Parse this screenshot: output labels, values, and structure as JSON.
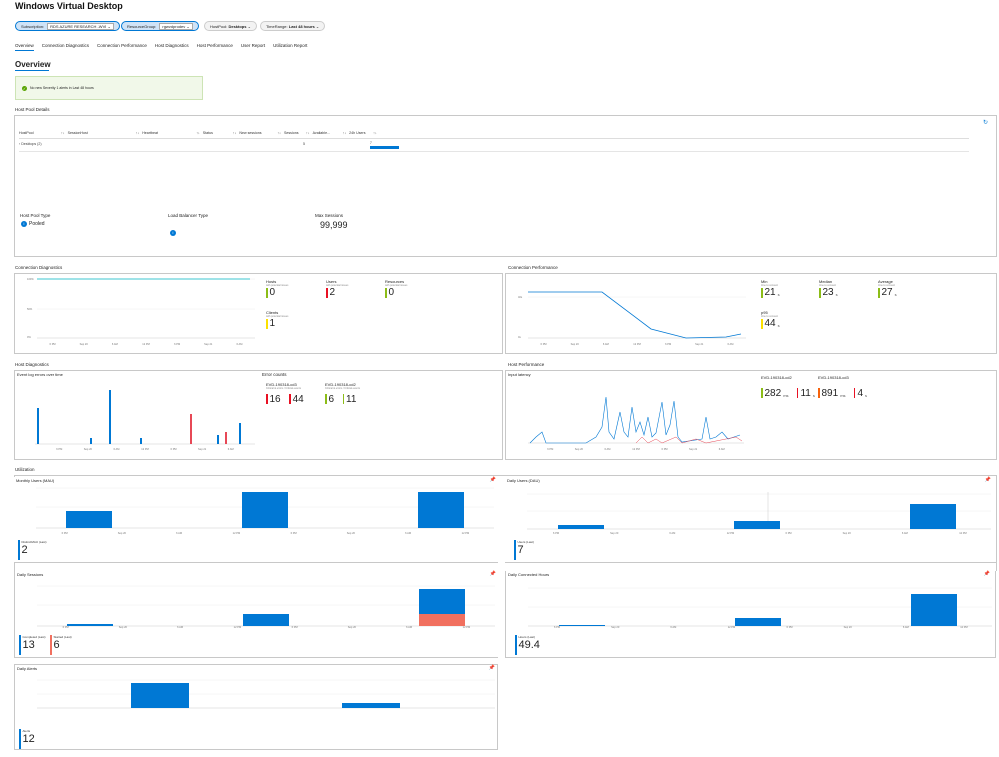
{
  "app_title": "Windows Virtual Desktop",
  "filters": [
    {
      "label": "Subscription:",
      "value": "RDS AZURE RESEARCH -WVI"
    },
    {
      "label": "ResourceGroup:",
      "value": "rgwvdprodev"
    },
    {
      "label": "HostPool:",
      "value": "Desktops"
    },
    {
      "label": "TimeRange:",
      "value": "Last 48 hours"
    }
  ],
  "tabs": [
    "Overview",
    "Connection Diagnostics",
    "Connection Performance",
    "Host Diagnostics",
    "Host Performance",
    "User Report",
    "Utilization Report"
  ],
  "overview": {
    "heading": "Overview",
    "alert_text": "No new Severity 1 alerts in Last 48 hours"
  },
  "hostpool": {
    "section_title": "Host Pool Details",
    "columns": [
      "HostPool",
      "SessionHost",
      "Heartbeat",
      "Status",
      "New sessions",
      "Sessions",
      "Available...",
      "24h Users"
    ],
    "row": {
      "hostpool": "Desktops (2)",
      "sessions": "5",
      "users": "7"
    },
    "props": [
      {
        "label": "Host Pool Type",
        "value": "Pooled"
      },
      {
        "label": "Load Balancer Type",
        "value": ""
      },
      {
        "label": "Max Sessions",
        "value": "99,999"
      }
    ]
  },
  "conn_diag": {
    "section_title": "Connection Diagnostics",
    "y_ticks": [
      "100%",
      "50%",
      "0%"
    ],
    "x_ticks": [
      "6 PM",
      "Sep 20",
      "6 AM",
      "12 PM",
      "6 PM",
      "Sep 21",
      "6 AM"
    ],
    "kpis": [
      {
        "label": "Hosts",
        "sub": "with potential issues",
        "value": "0",
        "color": "#8cbd18"
      },
      {
        "label": "Users",
        "sub": "with potential issues",
        "value": "2",
        "color": "#e81123"
      },
      {
        "label": "Resources",
        "sub": "with potential issues",
        "value": "0",
        "color": "#8cbd18"
      },
      {
        "label": "Clients",
        "sub": "with potential issues",
        "value": "1",
        "color": "#fce100"
      }
    ]
  },
  "conn_perf": {
    "section_title": "Connection Performance",
    "y_ticks": [
      "40s",
      "20s",
      "0s"
    ],
    "x_ticks": [
      "6 PM",
      "Sep 20",
      "6 AM",
      "12 PM",
      "6 PM",
      "Sep 21",
      "6 AM"
    ],
    "kpis": [
      {
        "label": "Min",
        "sub": "time to connect",
        "value": "21",
        "unit": "s",
        "color": "#8cbd18"
      },
      {
        "label": "Median",
        "sub": "time to connect",
        "value": "23",
        "unit": "s",
        "color": "#8cbd18"
      },
      {
        "label": "Average",
        "sub": "time to connect",
        "value": "27",
        "unit": "s",
        "color": "#8cbd18"
      },
      {
        "label": "p95",
        "sub": "time to connect",
        "value": "44",
        "unit": "s",
        "color": "#fce100"
      }
    ]
  },
  "host_diag": {
    "section_title": "Host Diagnostics",
    "chart_title": "Event log errors over time",
    "error_counts_title": "Error counts",
    "x_ticks": [
      "6 PM",
      "Sep 20",
      "6 AM",
      "12 PM",
      "6 PM",
      "Sep 21",
      "6 AM"
    ],
    "hosts": [
      {
        "name": "EVD-190318-cd3",
        "sub": "Critical & errors / Critical events",
        "a": "16",
        "b": "44",
        "ca": "#e81123",
        "cb": "#e81123"
      },
      {
        "name": "EVD-190318-cd2",
        "sub": "Critical & errors / Critical events",
        "a": "6",
        "b": "11",
        "ca": "#8cbd18",
        "cb": "#8cbd18"
      }
    ]
  },
  "host_perf": {
    "section_title": "Host Performance",
    "chart_title": "Input latency",
    "x_ticks": [
      "6 PM",
      "Sep 20",
      "6 AM",
      "12 PM",
      "6 PM",
      "Sep 21",
      "6 AM"
    ],
    "hosts": [
      {
        "name": "EVD-190318-cd2",
        "a": "282",
        "au": "ms",
        "b": "11",
        "bu": "s",
        "ca": "#8cbd18",
        "cb": "#e81123"
      },
      {
        "name": "EVD-190318-cd3",
        "a": "891",
        "au": "ms",
        "b": "4",
        "bu": "s",
        "ca": "#f7630c",
        "cb": "#e81123"
      }
    ]
  },
  "utilization": {
    "section_title": "Utilization",
    "mau": {
      "title": "Monthly Users (MAU)",
      "kpi_label": "DistinctMAU (Last)",
      "kpi_value": "2"
    },
    "dau": {
      "title": "Daily Users (DAU)",
      "kpi_label": "Users (Last)",
      "kpi_value": "7"
    },
    "sessions": {
      "title": "Daily Sessions",
      "kpi1_label": "Completed (Last)",
      "kpi1_value": "13",
      "kpi2_label": "Started (Last)",
      "kpi2_value": "6"
    },
    "hours": {
      "title": "Daily Connected Hours",
      "kpi_label": "Hours (Last)",
      "kpi_value": "49.4"
    },
    "alerts": {
      "title": "Daily Alerts",
      "kpi_label": "Alerts",
      "kpi_value": "12"
    },
    "x_ticks": [
      "6 PM",
      "Sep 20",
      "6 AM",
      "12 PM",
      "6 PM",
      "Sep 20",
      "6 AM",
      "12 PM"
    ]
  },
  "chart_data": [
    {
      "type": "line",
      "title": "Connection Diagnostics",
      "x": [
        "6 PM",
        "Sep 20",
        "6 AM",
        "12 PM",
        "6 PM",
        "Sep 21",
        "6 AM"
      ],
      "series": [
        {
          "values": [
            100,
            100,
            100,
            100,
            100,
            100,
            100
          ]
        }
      ],
      "ylim": [
        0,
        100
      ]
    },
    {
      "type": "line",
      "title": "Connection Performance",
      "x": [
        "6 PM",
        "Sep 20",
        "6 AM",
        "12 PM",
        "6 PM",
        "Sep 21",
        "6 AM"
      ],
      "series": [
        {
          "values": [
            27,
            27,
            27,
            5,
            1,
            1,
            3
          ]
        }
      ],
      "ylim": [
        0,
        40
      ]
    },
    {
      "type": "bar",
      "title": "Event log errors over time",
      "series": [
        {
          "values": [
            12,
            0,
            0,
            2,
            18,
            0,
            2,
            0,
            0,
            0,
            0,
            3,
            4,
            7
          ]
        }
      ]
    },
    {
      "type": "bar",
      "title": "Monthly Users (MAU)",
      "series": [
        {
          "values": [
            1,
            2,
            2
          ]
        }
      ],
      "ylim": [
        0,
        2
      ]
    },
    {
      "type": "bar",
      "title": "Daily Users (DAU)",
      "series": [
        {
          "values": [
            1,
            2,
            7
          ]
        }
      ],
      "ylim": [
        0,
        10
      ]
    },
    {
      "type": "bar",
      "title": "Daily Sessions",
      "series": [
        {
          "name": "Completed",
          "values": [
            1,
            6,
            13
          ]
        },
        {
          "name": "Started",
          "values": [
            0,
            0,
            6
          ]
        }
      ],
      "ylim": [
        0,
        20
      ]
    },
    {
      "type": "bar",
      "title": "Daily Connected Hours",
      "series": [
        {
          "values": [
            1,
            15,
            49.4
          ]
        }
      ],
      "ylim": [
        0,
        60
      ]
    },
    {
      "type": "bar",
      "title": "Daily Alerts",
      "series": [
        {
          "values": [
            9,
            2
          ]
        }
      ],
      "ylim": [
        0,
        10
      ]
    }
  ]
}
